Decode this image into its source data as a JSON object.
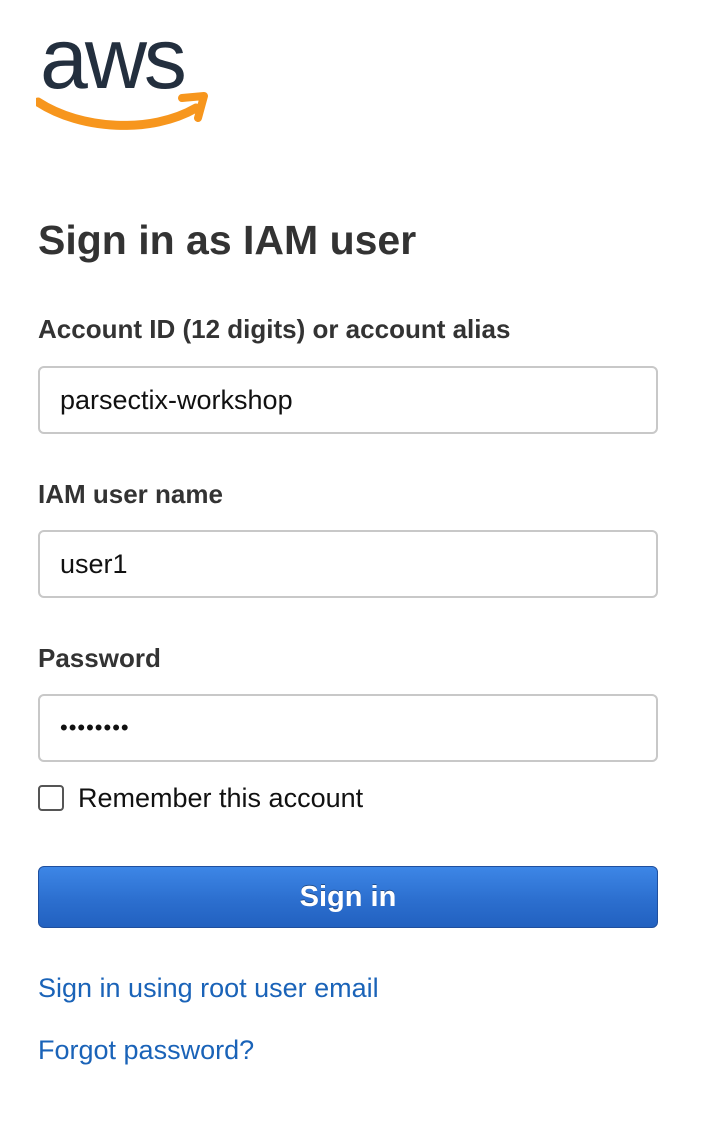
{
  "logo": {
    "text": "aws",
    "text_color": "#232f3e",
    "smile_color": "#f7961d"
  },
  "page": {
    "title": "Sign in as IAM user"
  },
  "form": {
    "account": {
      "label": "Account ID (12 digits) or account alias",
      "value": "parsectix-workshop"
    },
    "username": {
      "label": "IAM user name",
      "value": "user1"
    },
    "password": {
      "label": "Password",
      "value": "••••••••"
    },
    "remember": {
      "label": "Remember this account",
      "checked": false
    },
    "submit_label": "Sign in"
  },
  "links": {
    "root_user": "Sign in using root user email",
    "forgot_password": "Forgot password?"
  },
  "colors": {
    "link": "#1a63b8",
    "button": "#2c6fcf",
    "text": "#333333"
  }
}
